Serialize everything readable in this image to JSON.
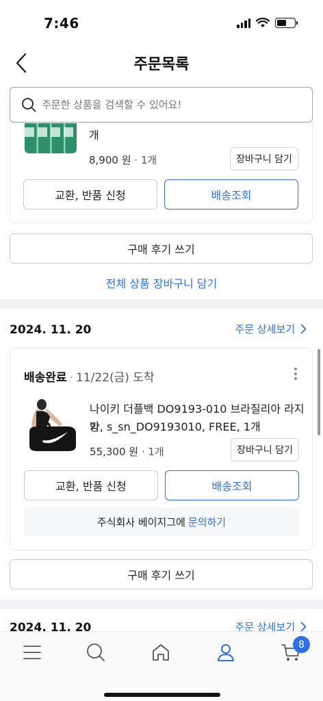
{
  "status_bar": {
    "time": "7:46",
    "battery_level": 0.55
  },
  "header": {
    "title": "주문목록"
  },
  "search": {
    "placeholder": "주문한 상품을 검색할 수 있어요!"
  },
  "partial_order": {
    "name_tail": "개",
    "price": "8,900 원",
    "qty": "· 1개",
    "cart_label": "장바구니 담기",
    "exchange_label": "교환, 반품 신청",
    "tracking_label": "배송조회",
    "review_label": "구매 후기 쓰기",
    "add_all_label": "전체 상품 장바구니 담기"
  },
  "order_1": {
    "date": "2024. 11. 20",
    "detail_label": "주문 상세보기",
    "status": "배송완료",
    "status_sep": "·",
    "arrival": "11/22(금) 도착",
    "product_line1": "나이키 더플백 DO9193-010 브라질리아 라지 가",
    "product_line2": "방, s_sn_DO9193010, FREE, 1개",
    "price": "55,300 원",
    "qty": "· 1개",
    "cart_label": "장바구니 담기",
    "exchange_label": "교환, 반품 신청",
    "tracking_label": "배송조회",
    "seller_text": "주식회사 베이지그에",
    "inquiry_label": "문의하기",
    "review_label": "구매 후기 쓰기"
  },
  "order_2": {
    "date": "2024. 11. 20",
    "detail_label": "주문 상세보기"
  },
  "bottom_nav": {
    "items": [
      "menu-icon",
      "search-icon",
      "home-icon",
      "my-page-icon",
      "cart-icon"
    ],
    "cart_badge": "8"
  },
  "colors": {
    "accent": "#2f6fe4",
    "text": "#111111",
    "border": "#c8ccd1",
    "separator": "#f2f3f5"
  }
}
